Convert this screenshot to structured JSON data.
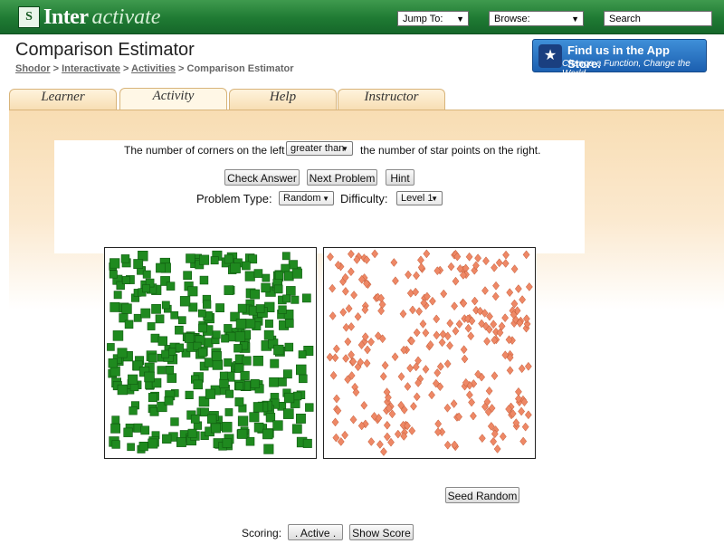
{
  "header": {
    "logo_main": "Inter",
    "logo_italic": "activate",
    "jump_to": "Jump To:",
    "browse": "Browse:",
    "search_placeholder": "Search"
  },
  "page": {
    "title": "Comparison Estimator",
    "breadcrumb": {
      "shodor": "Shodor",
      "interactivate": "Interactivate",
      "activities": "Activities",
      "current": "Comparison Estimator",
      "separator": ">"
    }
  },
  "appstore": {
    "line1": "Find us in the App Store.",
    "line2": "Change a Function, Change the World"
  },
  "tabs": [
    {
      "label": "Learner"
    },
    {
      "label": "Activity"
    },
    {
      "label": "Help"
    },
    {
      "label": "Instructor"
    }
  ],
  "activity": {
    "question_prefix": "The number of corners on the left is",
    "comparison_value": "greater than",
    "question_suffix": "the number of star points on the right.",
    "check_answer": "Check Answer",
    "next_problem": "Next Problem",
    "hint": "Hint",
    "problem_type_label": "Problem Type:",
    "problem_type_value": "Random",
    "difficulty_label": "Difficulty:",
    "difficulty_value": "Level 1",
    "seed_random": "Seed Random",
    "scoring_label": "Scoring:",
    "scoring_value": ". Active .",
    "show_score": "Show Score"
  },
  "colors": {
    "square_fill": "#1f8a1f",
    "square_edge": "#0f5a0f",
    "diamond_fill": "#ee8866",
    "diamond_edge": "#c05530"
  }
}
